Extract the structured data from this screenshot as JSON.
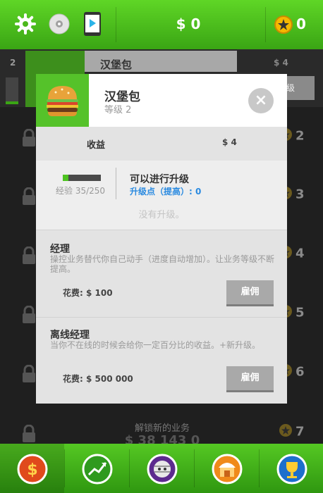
{
  "top_bar": {
    "icons": [
      "settings-gear-icon",
      "cd-disc-icon",
      "google-play-icon"
    ],
    "money": "$ 0",
    "coins": "0"
  },
  "background": {
    "first_row": {
      "left_number": "2",
      "title": "汉堡包",
      "price": "$ 4",
      "btn_frag": "级"
    },
    "row_levels": [
      "2",
      "3",
      "4",
      "5",
      "6",
      "7"
    ],
    "unlock_label": "解锁新的业务",
    "unlock_cost": "$ 38 143 0"
  },
  "modal": {
    "title": "汉堡包",
    "level": "等级 2",
    "close": "×",
    "income_label": "收益",
    "income_value": "$ 4",
    "xp_text": "经验 35/250",
    "xp_fraction": 0.14,
    "upgrade_title": "可以进行升级",
    "upgrade_points": "升级点（提高）: 0",
    "no_upgrade": "没有升级。",
    "manager": {
      "title": "经理",
      "desc": "操控业务替代你自己动手（进度自动增加）。让业务等级不断提高。",
      "cost": "花费: $ 100",
      "button": "雇佣"
    },
    "offline_manager": {
      "title": "离线经理",
      "desc": "当你不在线的时候会给你一定百分比的收益。+新升级。",
      "cost": "花费: $ 500 000",
      "button": "雇佣"
    }
  },
  "bottom_tabs": [
    {
      "icon": "dollar-coin-icon"
    },
    {
      "icon": "trend-chart-icon"
    },
    {
      "icon": "mummy-face-icon"
    },
    {
      "icon": "shop-store-icon"
    },
    {
      "icon": "trophy-icon"
    }
  ],
  "colors": {
    "brand_green": "#4cc21f",
    "link_blue": "#2a8ae0",
    "gold": "#f5b800"
  }
}
